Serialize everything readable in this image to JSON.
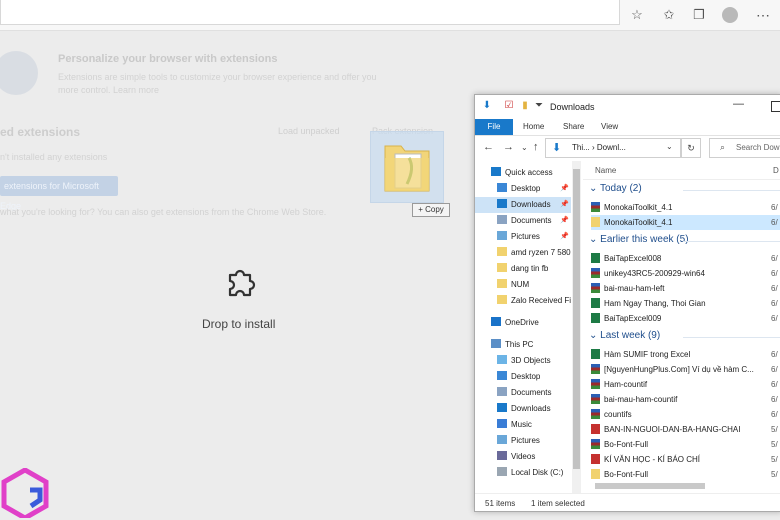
{
  "browser": {
    "extensions_page": {
      "promo_title": "Personalize your browser with extensions",
      "promo_text": "Extensions are simple tools to customize your browser experience and offer you more control. Learn more",
      "installed_title": "ed extensions",
      "load_unpacked": "Load unpacked",
      "pack_extension": "Pack extension",
      "no_extensions": "n't installed any extensions",
      "get_extensions_button": "extensions for Microsoft Edge",
      "cant_find": "what you're looking for? You can also get extensions from the Chrome Web Store.",
      "drop_label": "Drop to install"
    },
    "toolbar_icons": [
      "favorites-add-icon",
      "favorites-icon",
      "collections-icon",
      "profile-icon",
      "more-icon"
    ]
  },
  "drag": {
    "copy_label": "+ Copy"
  },
  "explorer": {
    "title": "Downloads",
    "ribbon_tabs": [
      "File",
      "Home",
      "Share",
      "View"
    ],
    "path": "Thi... › Downl...",
    "search_placeholder": "Search Dow",
    "nav_items": [
      {
        "label": "Quick access",
        "icon": "star",
        "pinned": false,
        "selected": false
      },
      {
        "label": "Desktop",
        "icon": "desktop",
        "pinned": true,
        "selected": false
      },
      {
        "label": "Downloads",
        "icon": "download",
        "pinned": true,
        "selected": true
      },
      {
        "label": "Documents",
        "icon": "document",
        "pinned": true,
        "selected": false
      },
      {
        "label": "Pictures",
        "icon": "picture",
        "pinned": true,
        "selected": false
      },
      {
        "label": "amd ryzen 7 580",
        "icon": "folder",
        "pinned": false,
        "selected": false
      },
      {
        "label": "dang tin fb",
        "icon": "folder",
        "pinned": false,
        "selected": false
      },
      {
        "label": "NUM",
        "icon": "folder",
        "pinned": false,
        "selected": false
      },
      {
        "label": "Zalo Received Fi",
        "icon": "folder",
        "pinned": false,
        "selected": false
      },
      {
        "label": "OneDrive",
        "icon": "cloud",
        "pinned": false,
        "selected": false
      },
      {
        "label": "This PC",
        "icon": "pc",
        "pinned": false,
        "selected": false
      },
      {
        "label": "3D Objects",
        "icon": "cube",
        "pinned": false,
        "selected": false
      },
      {
        "label": "Desktop",
        "icon": "desktop",
        "pinned": false,
        "selected": false
      },
      {
        "label": "Documents",
        "icon": "document",
        "pinned": false,
        "selected": false
      },
      {
        "label": "Downloads",
        "icon": "download",
        "pinned": false,
        "selected": false
      },
      {
        "label": "Music",
        "icon": "music",
        "pinned": false,
        "selected": false
      },
      {
        "label": "Pictures",
        "icon": "picture",
        "pinned": false,
        "selected": false
      },
      {
        "label": "Videos",
        "icon": "video",
        "pinned": false,
        "selected": false
      },
      {
        "label": "Local Disk (C:)",
        "icon": "disk",
        "pinned": false,
        "selected": false
      }
    ],
    "columns": {
      "name": "Name",
      "date": "D"
    },
    "groups": [
      {
        "label": "Today (2)",
        "files": [
          {
            "name": "MonokaiToolkit_4.1",
            "type": "rar",
            "date": "6/",
            "selected": false
          },
          {
            "name": "MonokaiToolkit_4.1",
            "type": "folder",
            "date": "6/",
            "selected": true
          }
        ]
      },
      {
        "label": "Earlier this week (5)",
        "files": [
          {
            "name": "BaiTapExcel008",
            "type": "xls",
            "date": "6/",
            "selected": false
          },
          {
            "name": "unikey43RC5-200929-win64",
            "type": "rar",
            "date": "6/",
            "selected": false
          },
          {
            "name": "bai-mau-ham-left",
            "type": "rar",
            "date": "6/",
            "selected": false
          },
          {
            "name": "Ham Ngay Thang, Thoi Gian",
            "type": "xls",
            "date": "6/",
            "selected": false
          },
          {
            "name": "BaiTapExcel009",
            "type": "xls",
            "date": "6/",
            "selected": false
          }
        ]
      },
      {
        "label": "Last week (9)",
        "files": [
          {
            "name": "Hàm SUMIF trong Excel",
            "type": "xls",
            "date": "6/",
            "selected": false
          },
          {
            "name": "[NguyenHungPlus.Com] Ví dụ về hàm C...",
            "type": "rar",
            "date": "6/",
            "selected": false
          },
          {
            "name": "Ham-countif",
            "type": "rar",
            "date": "6/",
            "selected": false
          },
          {
            "name": "bai-mau-ham-countif",
            "type": "rar",
            "date": "6/",
            "selected": false
          },
          {
            "name": "countifs",
            "type": "rar",
            "date": "6/",
            "selected": false
          },
          {
            "name": "BAN-IN-NGUOI-DAN-BA-HANG-CHAI",
            "type": "pdf",
            "date": "5/",
            "selected": false
          },
          {
            "name": "Bo-Font-Full",
            "type": "rar",
            "date": "5/",
            "selected": false
          },
          {
            "name": "KÍ VĂN HỌC - KÍ BÁO CHÍ",
            "type": "pdf",
            "date": "5/",
            "selected": false
          },
          {
            "name": "Bo-Font-Full",
            "type": "folder",
            "date": "5/",
            "selected": false
          }
        ]
      }
    ],
    "status": {
      "count": "51 items",
      "selected": "1 item selected"
    }
  }
}
